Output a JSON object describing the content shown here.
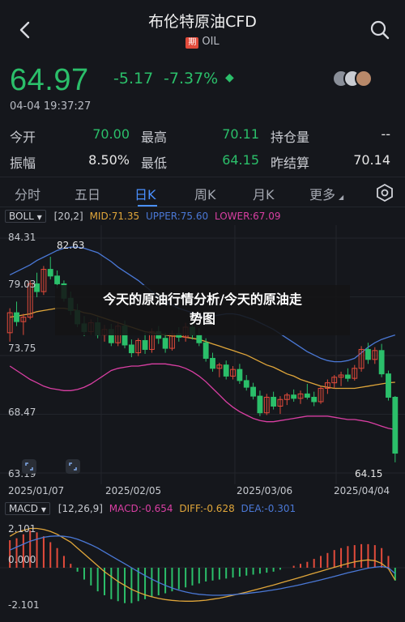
{
  "header": {
    "title": "布伦特原油CFD",
    "badge": "期",
    "symbol": "OIL"
  },
  "quote": {
    "price": "64.97",
    "change": "-5.17",
    "change_pct": "-7.37%",
    "timestamp": "04-04 19:37:27"
  },
  "stats": {
    "open_label": "今开",
    "open_value": "70.00",
    "high_label": "最高",
    "high_value": "70.11",
    "oi_label": "持仓量",
    "oi_value": "--",
    "amp_label": "振幅",
    "amp_value": "8.50%",
    "low_label": "最低",
    "low_value": "64.15",
    "prev_label": "昨结算",
    "prev_value": "70.14"
  },
  "tabs": [
    "分时",
    "五日",
    "日K",
    "周K",
    "月K",
    "更多"
  ],
  "active_tab": "日K",
  "boll": {
    "select": "BOLL",
    "params": "[20,2]",
    "mid": "MID:71.35",
    "upper": "UPPER:75.60",
    "lower": "LOWER:67.09"
  },
  "chart_labels": {
    "y": [
      "84.31",
      "79.03",
      "73.75",
      "68.47",
      "63.19"
    ],
    "max_annot": "82.63",
    "min_annot": "64.15",
    "x": [
      "2025/01/07",
      "2025/02/05",
      "2025/03/06",
      "2025/04/04"
    ]
  },
  "overlay": {
    "line1": "今天的原油行情分析/今天的原油走",
    "line2": "势图"
  },
  "macd": {
    "select": "MACD",
    "params": "[12,26,9]",
    "macd": "MACD:-0.654",
    "diff": "DIFF:-0.628",
    "dea": "DEA:-0.301",
    "y_top": "2.101",
    "y_mid": "0.000",
    "y_bot": "-2.101"
  },
  "colors": {
    "up": "#e24b3b",
    "down": "#2bbf6a",
    "mid": "#e0a63a",
    "upper": "#4a78d6",
    "lower": "#d93fa3",
    "accent": "#4a90ff"
  },
  "chart_data": {
    "type": "candlestick",
    "price_range": [
      63.19,
      84.31
    ],
    "candles": [
      {
        "o": 75.8,
        "h": 78.0,
        "l": 75.0,
        "c": 77.6
      },
      {
        "o": 77.6,
        "h": 78.6,
        "l": 76.4,
        "c": 76.8
      },
      {
        "o": 76.8,
        "h": 77.5,
        "l": 75.6,
        "c": 77.2
      },
      {
        "o": 77.2,
        "h": 80.5,
        "l": 77.0,
        "c": 80.2
      },
      {
        "o": 80.2,
        "h": 81.2,
        "l": 79.0,
        "c": 79.5
      },
      {
        "o": 79.5,
        "h": 81.8,
        "l": 79.2,
        "c": 81.5
      },
      {
        "o": 81.5,
        "h": 82.63,
        "l": 80.6,
        "c": 80.9
      },
      {
        "o": 80.9,
        "h": 81.4,
        "l": 79.8,
        "c": 80.2
      },
      {
        "o": 80.2,
        "h": 80.5,
        "l": 78.6,
        "c": 78.9
      },
      {
        "o": 78.9,
        "h": 79.5,
        "l": 77.4,
        "c": 77.8
      },
      {
        "o": 77.8,
        "h": 78.4,
        "l": 76.3,
        "c": 76.6
      },
      {
        "o": 76.6,
        "h": 77.3,
        "l": 75.5,
        "c": 75.9
      },
      {
        "o": 75.9,
        "h": 77.0,
        "l": 75.6,
        "c": 76.7
      },
      {
        "o": 76.7,
        "h": 77.2,
        "l": 75.3,
        "c": 75.6
      },
      {
        "o": 75.6,
        "h": 76.5,
        "l": 75.0,
        "c": 76.1
      },
      {
        "o": 76.1,
        "h": 76.6,
        "l": 74.6,
        "c": 74.9
      },
      {
        "o": 74.9,
        "h": 76.8,
        "l": 74.6,
        "c": 76.4
      },
      {
        "o": 76.4,
        "h": 76.9,
        "l": 74.4,
        "c": 74.7
      },
      {
        "o": 74.7,
        "h": 75.2,
        "l": 73.6,
        "c": 74.0
      },
      {
        "o": 74.0,
        "h": 75.3,
        "l": 73.7,
        "c": 75.1
      },
      {
        "o": 75.1,
        "h": 75.8,
        "l": 73.9,
        "c": 74.3
      },
      {
        "o": 74.3,
        "h": 76.2,
        "l": 74.0,
        "c": 75.9
      },
      {
        "o": 75.9,
        "h": 76.4,
        "l": 74.8,
        "c": 75.3
      },
      {
        "o": 75.3,
        "h": 75.8,
        "l": 74.0,
        "c": 74.4
      },
      {
        "o": 74.4,
        "h": 76.0,
        "l": 74.2,
        "c": 75.7
      },
      {
        "o": 75.7,
        "h": 76.3,
        "l": 75.0,
        "c": 75.4
      },
      {
        "o": 75.4,
        "h": 76.7,
        "l": 75.0,
        "c": 76.3
      },
      {
        "o": 76.3,
        "h": 76.8,
        "l": 75.2,
        "c": 75.6
      },
      {
        "o": 75.6,
        "h": 76.2,
        "l": 74.6,
        "c": 74.9
      },
      {
        "o": 74.9,
        "h": 75.3,
        "l": 73.2,
        "c": 73.5
      },
      {
        "o": 73.5,
        "h": 74.0,
        "l": 72.3,
        "c": 72.6
      },
      {
        "o": 72.6,
        "h": 73.1,
        "l": 71.8,
        "c": 72.9
      },
      {
        "o": 72.9,
        "h": 73.3,
        "l": 71.6,
        "c": 71.9
      },
      {
        "o": 71.9,
        "h": 72.8,
        "l": 71.6,
        "c": 72.5
      },
      {
        "o": 72.5,
        "h": 73.0,
        "l": 71.2,
        "c": 71.5
      },
      {
        "o": 71.5,
        "h": 72.0,
        "l": 70.6,
        "c": 70.9
      },
      {
        "o": 70.9,
        "h": 71.3,
        "l": 69.8,
        "c": 70.1
      },
      {
        "o": 70.1,
        "h": 70.6,
        "l": 68.3,
        "c": 68.6
      },
      {
        "o": 68.6,
        "h": 70.3,
        "l": 68.4,
        "c": 70.0
      },
      {
        "o": 70.0,
        "h": 70.5,
        "l": 68.9,
        "c": 69.2
      },
      {
        "o": 69.2,
        "h": 70.1,
        "l": 68.5,
        "c": 69.8
      },
      {
        "o": 69.8,
        "h": 70.4,
        "l": 69.3,
        "c": 70.2
      },
      {
        "o": 70.2,
        "h": 70.7,
        "l": 69.6,
        "c": 69.9
      },
      {
        "o": 69.9,
        "h": 70.6,
        "l": 69.4,
        "c": 70.3
      },
      {
        "o": 70.3,
        "h": 71.2,
        "l": 69.8,
        "c": 70.0
      },
      {
        "o": 70.0,
        "h": 70.5,
        "l": 69.2,
        "c": 69.6
      },
      {
        "o": 69.6,
        "h": 71.0,
        "l": 69.4,
        "c": 70.8
      },
      {
        "o": 70.8,
        "h": 71.6,
        "l": 70.3,
        "c": 71.3
      },
      {
        "o": 71.3,
        "h": 72.0,
        "l": 70.8,
        "c": 71.8
      },
      {
        "o": 71.8,
        "h": 72.3,
        "l": 71.0,
        "c": 72.0
      },
      {
        "o": 72.0,
        "h": 72.6,
        "l": 71.4,
        "c": 71.7
      },
      {
        "o": 71.7,
        "h": 72.9,
        "l": 71.5,
        "c": 72.6
      },
      {
        "o": 72.6,
        "h": 74.6,
        "l": 72.3,
        "c": 74.3
      },
      {
        "o": 74.3,
        "h": 74.9,
        "l": 73.0,
        "c": 73.4
      },
      {
        "o": 73.4,
        "h": 74.5,
        "l": 73.0,
        "c": 74.2
      },
      {
        "o": 74.2,
        "h": 74.8,
        "l": 71.8,
        "c": 72.1
      },
      {
        "o": 72.1,
        "h": 72.4,
        "l": 69.7,
        "c": 70.0
      },
      {
        "o": 70.0,
        "h": 70.11,
        "l": 64.15,
        "c": 64.97
      }
    ],
    "mid": [
      77.2,
      77.3,
      77.4,
      77.5,
      77.7,
      77.8,
      77.9,
      78.0,
      78.0,
      77.9,
      77.8,
      77.6,
      77.5,
      77.3,
      77.1,
      76.9,
      76.7,
      76.5,
      76.3,
      76.1,
      75.9,
      75.8,
      75.7,
      75.6,
      75.5,
      75.5,
      75.4,
      75.3,
      75.2,
      75.0,
      74.8,
      74.6,
      74.4,
      74.2,
      74.0,
      73.8,
      73.5,
      73.2,
      72.9,
      72.7,
      72.4,
      72.1,
      71.9,
      71.6,
      71.4,
      71.2,
      71.0,
      70.9,
      70.8,
      70.8,
      70.8,
      70.8,
      70.9,
      71.0,
      71.1,
      71.2,
      71.3,
      71.35
    ],
    "upper": [
      81.0,
      81.3,
      81.6,
      81.9,
      82.3,
      82.6,
      82.9,
      83.2,
      83.4,
      83.5,
      83.5,
      83.4,
      83.2,
      83.0,
      82.6,
      82.2,
      81.7,
      81.3,
      80.9,
      80.5,
      80.0,
      79.5,
      79.0,
      78.6,
      78.3,
      78.0,
      77.8,
      77.6,
      77.4,
      77.3,
      77.3,
      77.4,
      77.5,
      77.5,
      77.4,
      77.2,
      77.0,
      76.7,
      76.4,
      76.1,
      75.7,
      75.3,
      74.9,
      74.5,
      74.1,
      73.8,
      73.5,
      73.3,
      73.2,
      73.2,
      73.3,
      73.5,
      74.0,
      74.5,
      74.9,
      75.2,
      75.4,
      75.6
    ],
    "lower": [
      72.8,
      72.4,
      72.0,
      71.6,
      71.3,
      71.0,
      70.8,
      70.7,
      70.6,
      70.6,
      70.7,
      70.9,
      71.2,
      71.6,
      72.0,
      72.4,
      72.6,
      72.7,
      72.8,
      72.8,
      72.9,
      73.0,
      73.0,
      73.0,
      72.9,
      72.8,
      72.6,
      72.3,
      71.9,
      71.4,
      70.8,
      70.2,
      69.6,
      69.1,
      68.7,
      68.4,
      68.1,
      67.9,
      67.8,
      67.8,
      67.9,
      68.0,
      68.1,
      68.2,
      68.3,
      68.3,
      68.3,
      68.3,
      68.2,
      68.1,
      68.0,
      68.0,
      67.9,
      67.8,
      67.6,
      67.4,
      67.2,
      67.09
    ],
    "macd_hist": [
      1.4,
      1.5,
      1.7,
      1.9,
      1.8,
      1.6,
      1.3,
      1.0,
      0.6,
      0.2,
      -0.2,
      -0.6,
      -0.9,
      -1.2,
      -1.4,
      -1.6,
      -1.7,
      -1.8,
      -1.8,
      -1.7,
      -1.6,
      -1.5,
      -1.4,
      -1.3,
      -1.2,
      -1.1,
      -1.0,
      -0.9,
      -0.8,
      -0.7,
      -0.65,
      -0.6,
      -0.55,
      -0.5,
      -0.45,
      -0.4,
      -0.35,
      -0.3,
      -0.25,
      -0.2,
      -0.1,
      0.0,
      0.1,
      0.2,
      0.3,
      0.45,
      0.6,
      0.75,
      0.9,
      1.0,
      1.1,
      1.15,
      1.2,
      1.2,
      1.15,
      1.0,
      0.6,
      -0.654
    ],
    "diff": [
      1.6,
      1.8,
      1.9,
      2.0,
      2.0,
      1.95,
      1.85,
      1.7,
      1.5,
      1.3,
      1.0,
      0.7,
      0.4,
      0.1,
      -0.2,
      -0.45,
      -0.7,
      -0.9,
      -1.1,
      -1.25,
      -1.38,
      -1.48,
      -1.56,
      -1.62,
      -1.66,
      -1.69,
      -1.7,
      -1.7,
      -1.68,
      -1.65,
      -1.6,
      -1.55,
      -1.48,
      -1.4,
      -1.32,
      -1.24,
      -1.15,
      -1.06,
      -0.97,
      -0.88,
      -0.78,
      -0.68,
      -0.58,
      -0.48,
      -0.38,
      -0.28,
      -0.18,
      -0.08,
      0.02,
      0.12,
      0.22,
      0.3,
      0.36,
      0.4,
      0.36,
      0.22,
      -0.05,
      -0.628
    ],
    "dea": [
      0.9,
      1.05,
      1.2,
      1.35,
      1.45,
      1.55,
      1.6,
      1.62,
      1.6,
      1.55,
      1.45,
      1.32,
      1.17,
      1.0,
      0.8,
      0.6,
      0.4,
      0.2,
      0.0,
      -0.2,
      -0.4,
      -0.58,
      -0.75,
      -0.9,
      -1.03,
      -1.14,
      -1.23,
      -1.3,
      -1.35,
      -1.38,
      -1.4,
      -1.4,
      -1.39,
      -1.37,
      -1.34,
      -1.31,
      -1.27,
      -1.23,
      -1.18,
      -1.13,
      -1.07,
      -1.0,
      -0.93,
      -0.86,
      -0.78,
      -0.7,
      -0.62,
      -0.53,
      -0.44,
      -0.35,
      -0.26,
      -0.18,
      -0.1,
      -0.02,
      0.03,
      0.06,
      0.0,
      -0.301
    ]
  }
}
